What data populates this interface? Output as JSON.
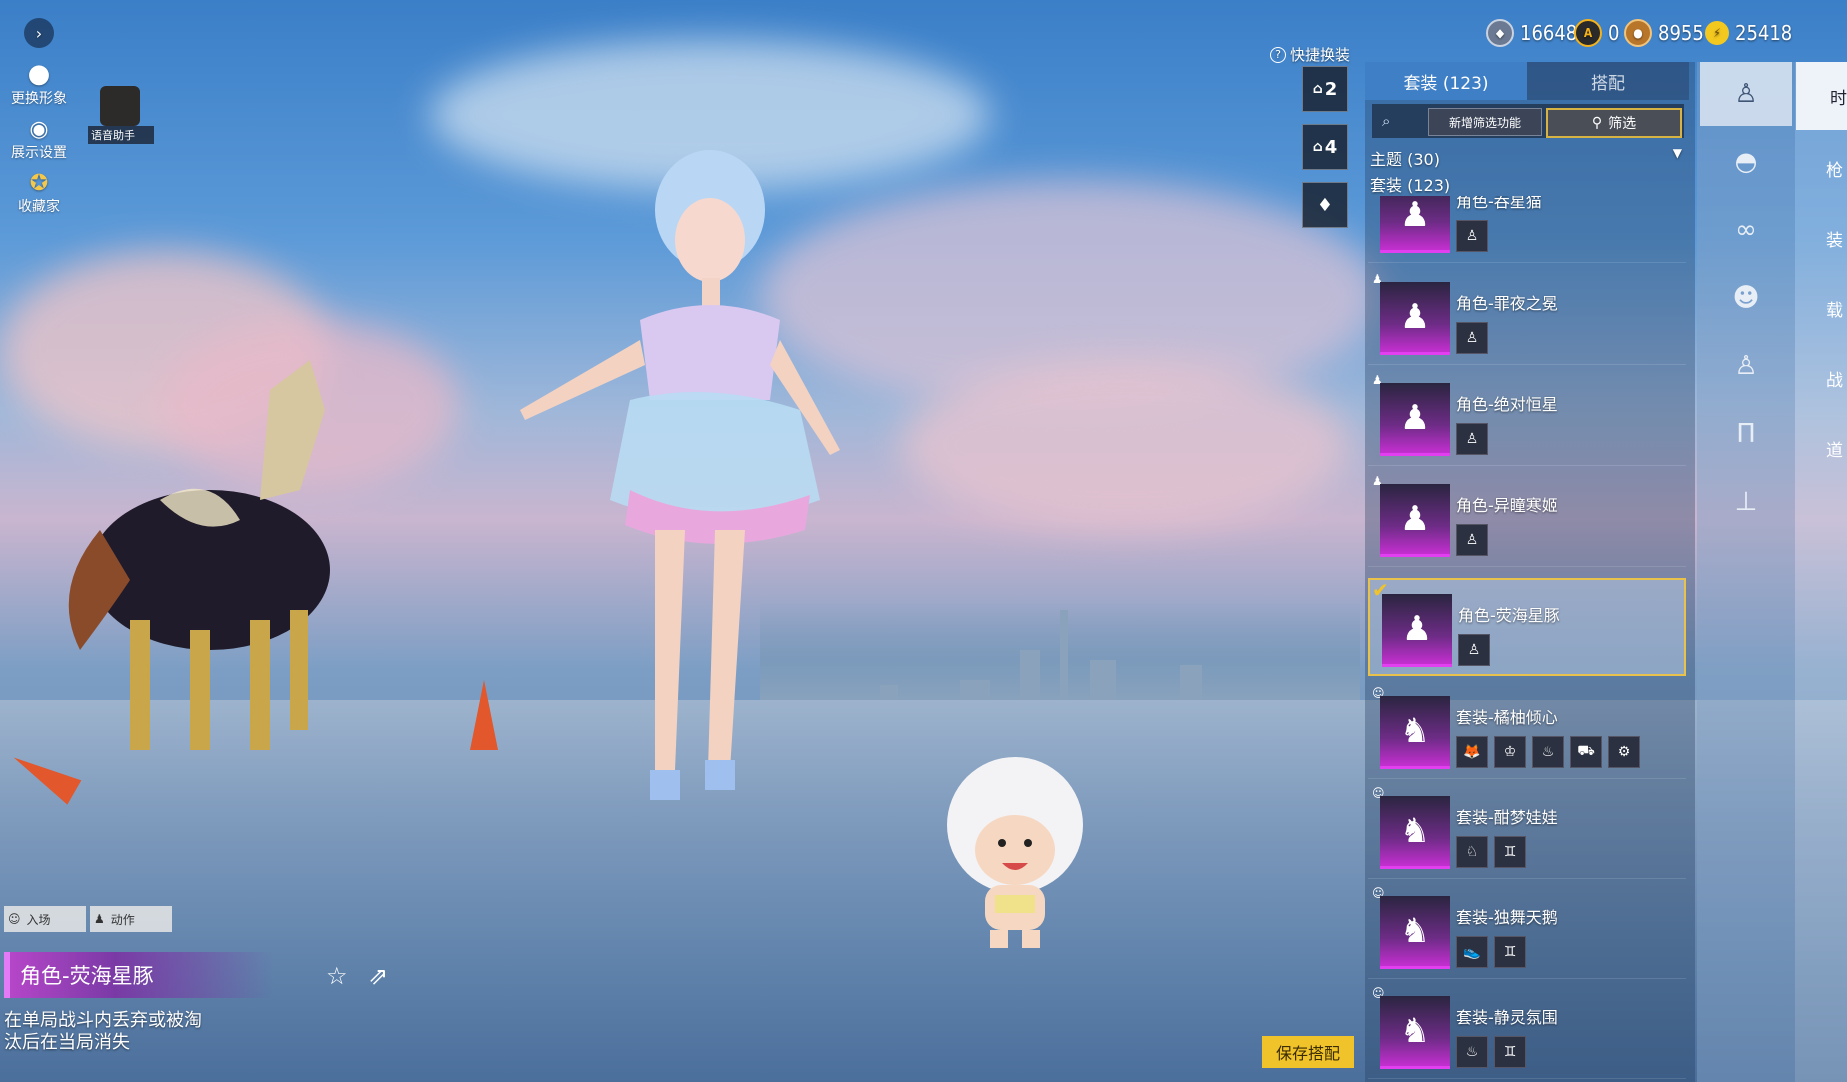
{
  "left_tools": {
    "expand_icon": "chevron-right-icon",
    "change_avatar": "更换形象",
    "display_settings": "展示设置",
    "collector": "收藏家",
    "voice_assistant": "语音助手"
  },
  "currencies": [
    {
      "icon": "gem-coin-icon",
      "value": "16648",
      "color": "#6b7a92"
    },
    {
      "icon": "a-coin-icon",
      "value": "0",
      "color": "#f1b21e"
    },
    {
      "icon": "bronze-coin-icon",
      "value": "8955",
      "color": "#b8762b"
    },
    {
      "icon": "lightning-coin-icon",
      "value": "25418",
      "color": "#f3c81f"
    }
  ],
  "quick_change": {
    "title": "快捷换装",
    "slot1": "2",
    "slot2": "4"
  },
  "tabs": {
    "suits": "套装 (123)",
    "match": "搭配"
  },
  "filters": {
    "new_filter": "新增筛选功能",
    "filter": "筛选"
  },
  "sections": {
    "theme": "主题 (30)",
    "suits": "套装 (123)"
  },
  "items": [
    {
      "name": "角色-吞星猫",
      "selected": false,
      "parts": [
        "figure-icon"
      ]
    },
    {
      "name": "角色-罪夜之冕",
      "selected": false,
      "parts": [
        "figure-icon"
      ]
    },
    {
      "name": "角色-绝对恒星",
      "selected": false,
      "parts": [
        "figure-icon"
      ]
    },
    {
      "name": "角色-异瞳寒姬",
      "selected": false,
      "parts": [
        "figure-icon"
      ]
    },
    {
      "name": "角色-荧海星豚",
      "selected": true,
      "parts": [
        "figure-icon"
      ]
    },
    {
      "name": "套装-橘柚倾心",
      "selected": false,
      "parts": [
        "fox-icon",
        "dress-icon",
        "bag-icon",
        "car-icon",
        "bike-icon"
      ]
    },
    {
      "name": "套装-酣梦娃娃",
      "selected": false,
      "parts": [
        "fox-icon",
        "pair-icon"
      ]
    },
    {
      "name": "套装-独舞天鹅",
      "selected": false,
      "parts": [
        "shoe-icon",
        "pair-icon"
      ]
    },
    {
      "name": "套装-静灵氛围",
      "selected": false,
      "parts": [
        "bag-icon",
        "pair-icon"
      ]
    }
  ],
  "categories": [
    "figure-icon",
    "cap-icon",
    "glasses-icon",
    "mask-icon",
    "body-icon",
    "pants-icon",
    "boots-icon"
  ],
  "far_right": [
    "时",
    "枪",
    "装",
    "载",
    "战",
    "道"
  ],
  "bottom_left": {
    "entrance": "入场",
    "action": "动作",
    "character_name": "角色-荧海星豚",
    "note": "在单局战斗内丢弃或被淘汰后在当局消失"
  },
  "save_button": "保存搭配"
}
